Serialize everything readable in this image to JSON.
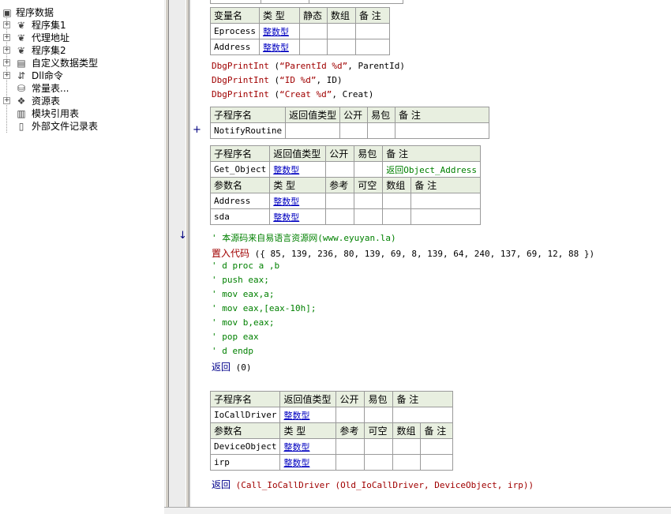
{
  "tree": {
    "root": "程序数据",
    "items": [
      {
        "label": "程序集1",
        "icon": "assembly-icon",
        "expander": "+"
      },
      {
        "label": "代理地址",
        "icon": "assembly-icon",
        "expander": "+"
      },
      {
        "label": "程序集2",
        "icon": "assembly-icon",
        "expander": "+"
      },
      {
        "label": "自定义数据类型",
        "icon": "datatype-icon",
        "expander": "+"
      },
      {
        "label": "Dll命令",
        "icon": "dll-icon",
        "expander": "+"
      },
      {
        "label": "常量表...",
        "icon": "constant-icon",
        "expander": ""
      },
      {
        "label": "资源表",
        "icon": "resource-icon",
        "expander": "+"
      },
      {
        "label": "模块引用表",
        "icon": "module-icon",
        "expander": ""
      },
      {
        "label": "外部文件记录表",
        "icon": "file-icon",
        "expander": ""
      }
    ]
  },
  "vars_table": {
    "headers": [
      "变量名",
      "类 型",
      "静态",
      "数组",
      "备 注"
    ],
    "rows": [
      [
        "Eprocess",
        "整数型",
        "",
        "",
        ""
      ],
      [
        "Address",
        "整数型",
        "",
        "",
        ""
      ]
    ]
  },
  "dbg_lines": [
    {
      "fn": "DbgPrintInt",
      "open": " (",
      "str": "“ParentId %d”",
      "rest": ", ParentId)"
    },
    {
      "fn": "DbgPrintInt",
      "open": " (",
      "str": "“ID %d”",
      "rest": ", ID)"
    },
    {
      "fn": "DbgPrintInt",
      "open": " (",
      "str": "“Creat %d”",
      "rest": ", Creat)"
    }
  ],
  "notify_table": {
    "marker": "+",
    "headers": [
      "子程序名",
      "返回值类型",
      "公开",
      "易包",
      "备 注"
    ],
    "row": [
      "NotifyRoutine",
      "",
      "",
      "",
      ""
    ]
  },
  "getobj_table": {
    "headers": [
      "子程序名",
      "返回值类型",
      "公开",
      "易包",
      "备 注"
    ],
    "row": [
      "Get_Object",
      "整数型",
      "",
      "",
      "返回Object_Address"
    ],
    "param_headers": [
      "参数名",
      "类 型",
      "参考",
      "可空",
      "数组",
      "备 注"
    ],
    "params": [
      [
        "Address",
        "整数型",
        "",
        "",
        "",
        ""
      ],
      [
        "sda",
        "整数型",
        "",
        "",
        "",
        ""
      ]
    ]
  },
  "code_block": {
    "marker": "↓",
    "comment_top": "' 本源码来自易语言资源网(www.eyuyan.la)",
    "embed_kw": "置入代码",
    "embed_args": " ({ 85, 139, 236, 80, 139, 69, 8, 139, 64, 240, 137, 69, 12, 88 })",
    "asm_comments": [
      "' d proc a ,b",
      "' push eax;",
      "' mov eax,a;",
      "' mov eax,[eax-10h];",
      "' mov b,eax;",
      "' pop eax",
      "' d endp"
    ],
    "return_kw": "返回",
    "return_args": " (0)"
  },
  "iocall_table": {
    "headers": [
      "子程序名",
      "返回值类型",
      "公开",
      "易包",
      "备 注"
    ],
    "row": [
      "IoCallDriver",
      "整数型",
      "",
      "",
      ""
    ],
    "param_headers": [
      "参数名",
      "类 型",
      "参考",
      "可空",
      "数组",
      "备 注"
    ],
    "params": [
      [
        "DeviceObject",
        "整数型",
        "",
        "",
        "",
        ""
      ],
      [
        "irp",
        "整数型",
        "",
        "",
        "",
        ""
      ]
    ]
  },
  "final_return": {
    "kw": "返回",
    "args": " (Call_IoCallDriver (Old_IoCallDriver, DeviceObject, irp))"
  }
}
